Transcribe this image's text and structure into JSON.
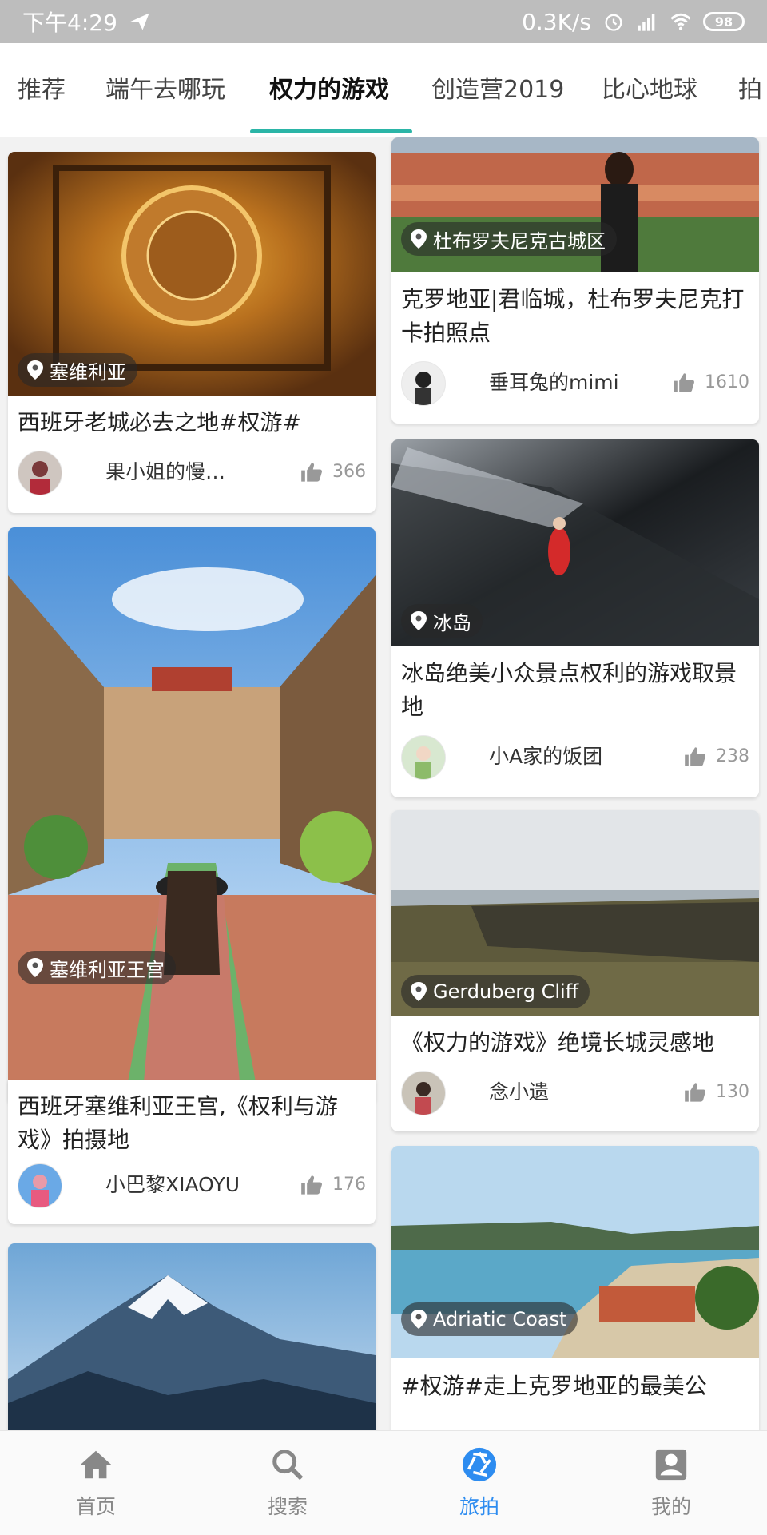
{
  "status_bar": {
    "time": "下午4:29",
    "network_speed": "0.3K/s",
    "battery": "98"
  },
  "tabs": [
    {
      "label": "推荐"
    },
    {
      "label": "端午去哪玩"
    },
    {
      "label": "权力的游戏"
    },
    {
      "label": "创造营2019"
    },
    {
      "label": "比心地球"
    },
    {
      "label": "拍"
    }
  ],
  "active_tab": "权力的游戏",
  "colors": {
    "accent": "#2bb5a7",
    "nav_active": "#2d8cf0"
  },
  "posts": [
    {
      "location": "塞维利亚",
      "title": "西班牙老城必去之地#权游#",
      "author": "果小姐的慢…",
      "likes": "366"
    },
    {
      "location": "塞维利亚王宫",
      "title": "西班牙塞维利亚王宫,《权利与游戏》拍摄地",
      "author": "小巴黎XIAOYU",
      "likes": "176"
    },
    {
      "location": "",
      "title": "",
      "author": "",
      "likes": ""
    },
    {
      "location": "杜布罗夫尼克古城区",
      "title": "克罗地亚|君临城，杜布罗夫尼克打卡拍照点",
      "author": "垂耳兔的mimi",
      "likes": "1610"
    },
    {
      "location": "冰岛",
      "title": "冰岛绝美小众景点权利的游戏取景地",
      "author": "小A家的饭团",
      "likes": "238"
    },
    {
      "location": "Gerduberg Cliff",
      "title": "《权力的游戏》绝境长城灵感地",
      "author": "念小遗",
      "likes": "130"
    },
    {
      "location": "Adriatic Coast",
      "title": "#权游#走上克罗地亚的最美公",
      "author": "",
      "likes": ""
    }
  ],
  "bottom_nav": [
    {
      "label": "首页",
      "icon": "home-icon"
    },
    {
      "label": "搜索",
      "icon": "search-icon"
    },
    {
      "label": "旅拍",
      "icon": "camera-aperture-icon"
    },
    {
      "label": "我的",
      "icon": "profile-icon"
    }
  ]
}
